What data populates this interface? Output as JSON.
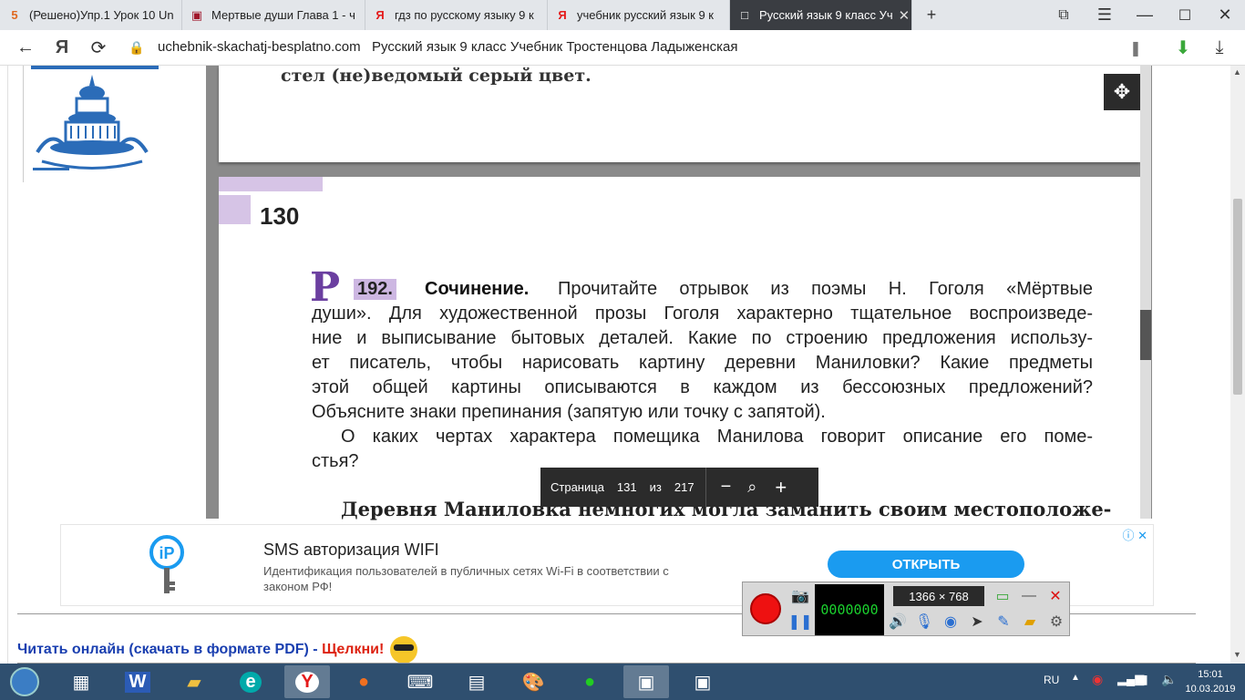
{
  "tabs": [
    {
      "label": "(Решено)Упр.1 Урок 10 Un",
      "favicon": "5",
      "favicon_color": "#e06820",
      "active": false
    },
    {
      "label": "Мертвые души Глава 1 - ч",
      "favicon": "▣",
      "favicon_color": "#a0162a",
      "active": false
    },
    {
      "label": "гдз по русскому языку 9 к",
      "favicon": "Я",
      "favicon_color": "#e41b1b",
      "active": false
    },
    {
      "label": "учебник русский язык 9 к",
      "favicon": "Я",
      "favicon_color": "#e41b1b",
      "active": false
    },
    {
      "label": "Русский язык 9 класс Уч",
      "favicon": "□",
      "favicon_color": "#ffffff",
      "active": true
    }
  ],
  "address": {
    "url": "uchebnik-skachatj-besplatno.com",
    "page_title": "Русский язык 9 класс Учебник Тростенцова Ладыженская"
  },
  "viewer": {
    "prev_page_text": "стел (не)ведомый серый цвет.",
    "page_number": "130",
    "section_mark": "Р",
    "exercise_number": "192.",
    "exercise_title": "Сочинение.",
    "lines": [
      "Прочитайте отрывок из поэмы Н. Гоголя «Мёртвые",
      "души». Для художественной прозы Гоголя характерно тщательное воспроизведе-",
      "ние и выписывание бытовых деталей. Какие по строению предложения использу-",
      "ет писатель, чтобы нарисовать картину деревни Маниловки? Какие предметы",
      "этой общей картины описываются в каждом из бессоюзных предложений?",
      "Объясните знаки препинания (запятую или точку с запятой).",
      "О каких чертах характера помещика Манилова говорит описание его поме-",
      "стья?"
    ],
    "reading_start": "Деревня Маниловка немногих могла заманить своим местоположе-",
    "page_toolbar": {
      "page_label": "Страница",
      "current": "131",
      "of_label": "из",
      "total": "217"
    }
  },
  "ad": {
    "title": "SMS авторизация WIFI",
    "description": "Идентификация пользователей в публичных сетях Wi-Fi в соответствии с законом РФ!",
    "button": "ОТКРЫТЬ"
  },
  "read_link": {
    "text": "Читать онлайн (скачать в формате PDF) - ",
    "emphasis": "Щелкни!"
  },
  "recorder": {
    "display": "0000000",
    "resolution": "1366 × 768"
  },
  "taskbar": {
    "language": "RU",
    "time": "15:01",
    "date": "10.03.2019"
  }
}
